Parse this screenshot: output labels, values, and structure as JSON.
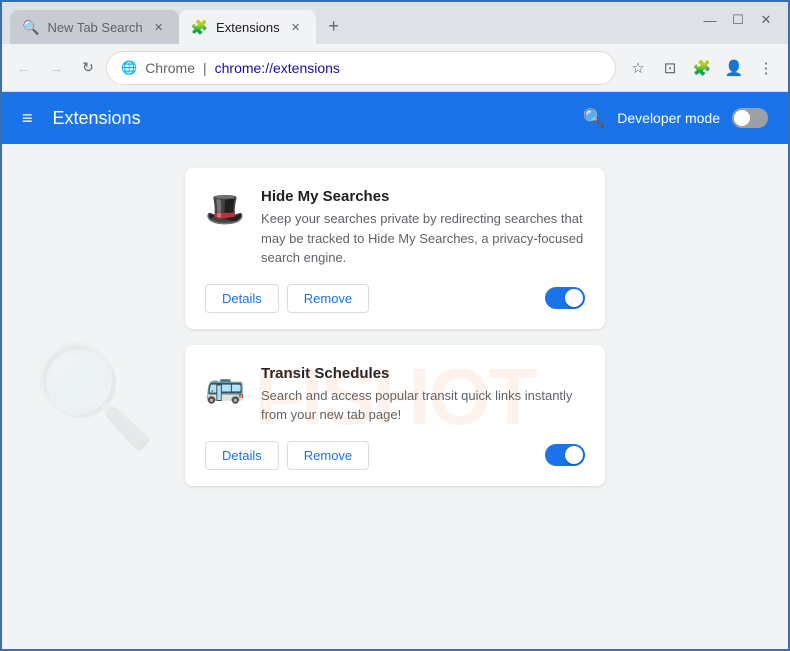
{
  "browser": {
    "window_controls": {
      "minimize": "—",
      "maximize": "☐",
      "close": "✕"
    },
    "tabs": [
      {
        "id": "tab-1",
        "title": "New Tab Search",
        "icon": "🔍",
        "active": false
      },
      {
        "id": "tab-2",
        "title": "Extensions",
        "icon": "🧩",
        "active": true
      }
    ],
    "new_tab_label": "+",
    "nav": {
      "back": "←",
      "forward": "→",
      "refresh": "↻"
    },
    "url_bar": {
      "chrome_label": "Chrome",
      "separator": "|",
      "url": "chrome://extensions"
    }
  },
  "extensions_page": {
    "header": {
      "menu_icon": "≡",
      "title": "Extensions",
      "search_icon": "🔍",
      "developer_mode_label": "Developer mode",
      "developer_mode_on": false
    },
    "extensions": [
      {
        "id": "hide-my-searches",
        "name": "Hide My Searches",
        "description": "Keep your searches private by redirecting searches that may be tracked to Hide My Searches, a privacy-focused search engine.",
        "icon": "🎩",
        "enabled": true,
        "details_label": "Details",
        "remove_label": "Remove"
      },
      {
        "id": "transit-schedules",
        "name": "Transit Schedules",
        "description": "Search and access popular transit quick links instantly from your new tab page!",
        "icon": "🚌",
        "enabled": true,
        "details_label": "Details",
        "remove_label": "Remove"
      }
    ]
  }
}
